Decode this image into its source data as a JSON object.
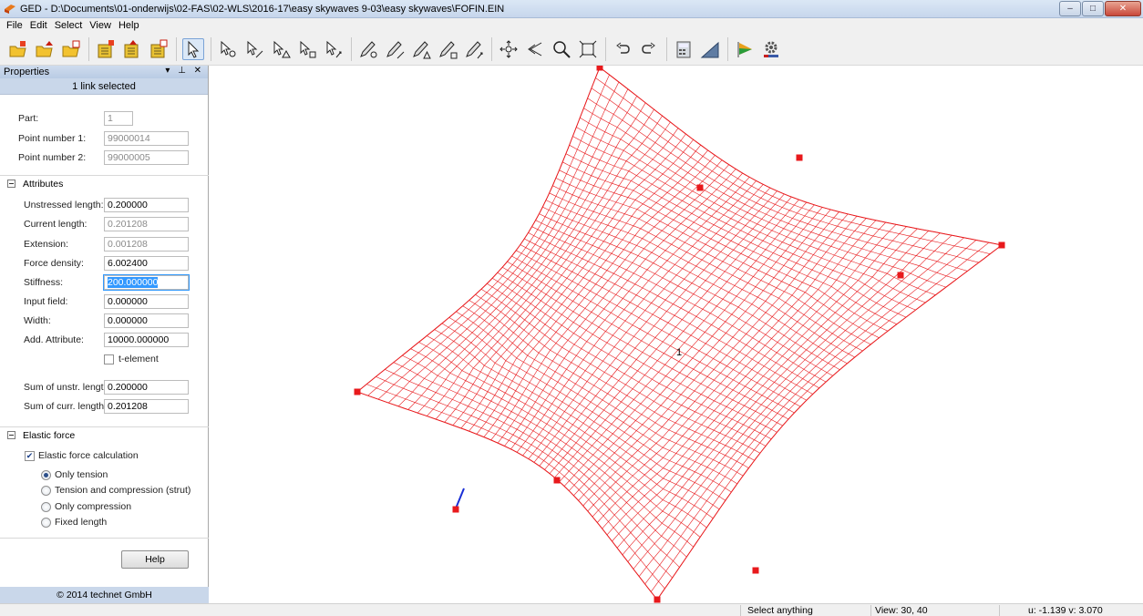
{
  "window": {
    "title": "GED - D:\\Documents\\01-onderwijs\\02-FAS\\02-WLS\\2016-17\\easy skywaves 9-03\\easy skywaves\\FOFIN.EIN",
    "buttons": {
      "minimize": "–",
      "maximize": "□",
      "close": "✕"
    }
  },
  "menu": [
    "File",
    "Edit",
    "Select",
    "View",
    "Help"
  ],
  "toolbar": {
    "groups": [
      [
        "new-folder-icon",
        "open-folder-icon",
        "save-folder-icon"
      ],
      [
        "new-file-icon",
        "open-file-icon",
        "save-file-icon"
      ],
      [
        "select-arrow-icon"
      ],
      [
        "select-point-icon",
        "select-link-icon",
        "select-triangle-icon",
        "select-rect-icon",
        "select-drag-icon"
      ],
      [
        "pen-point-icon",
        "pen-link-icon",
        "pen-triangle-icon",
        "pen-rect-icon",
        "pen-drag-icon"
      ],
      [
        "move-icon",
        "zoom-extent-icon",
        "zoom-icon",
        "fit-icon"
      ],
      [
        "undo-icon",
        "redo-icon"
      ],
      [
        "calculator-icon",
        "triangle-icon"
      ],
      [
        "flag-icon",
        "settings-icon"
      ]
    ]
  },
  "panel": {
    "title": "Properties",
    "header_icons": "▾ ⊥ ✕",
    "selection": "1 link selected",
    "general": {
      "part_label": "Part:",
      "part_value": "1",
      "point1_label": "Point number 1:",
      "point1_value": "99000014",
      "point2_label": "Point number 2:",
      "point2_value": "99000005"
    },
    "attributes": {
      "title": "Attributes",
      "unstressed_label": "Unstressed length:",
      "unstressed_value": "0.200000",
      "current_label": "Current  length:",
      "current_value": "0.201208",
      "extension_label": "Extension:",
      "extension_value": "0.001208",
      "force_density_label": "Force density:",
      "force_density_value": "6.002400",
      "stiffness_label": "Stiffness:",
      "stiffness_value": "200.000000",
      "input_field_label": "Input field:",
      "input_field_value": "0.000000",
      "width_label": "Width:",
      "width_value": "0.000000",
      "add_attr_label": "Add. Attribute:",
      "add_attr_value": "10000.000000",
      "t_element_label": "t-element",
      "t_element_checked": false,
      "sum_unstr_label": "Sum of unstr. lengths:",
      "sum_unstr_value": "0.200000",
      "sum_curr_label": "Sum of curr. lengths:",
      "sum_curr_value": "0.201208"
    },
    "elastic": {
      "title": "Elastic force",
      "calc_label": "Elastic force calculation",
      "calc_checked": true,
      "options": [
        "Only tension",
        "Tension and compression (strut)",
        "Only compression",
        "Fixed length"
      ],
      "selected": "Only tension"
    },
    "help_label": "Help",
    "footer": "© 2014 technet GmbH"
  },
  "canvas": {
    "label": "1",
    "mesh_color": "#e8191c",
    "selected_link_color": "#1a2fd6"
  },
  "status": {
    "message": "Select anything",
    "view": "View: 30, 40",
    "coords": "u: -1.139 v: 3.070"
  }
}
